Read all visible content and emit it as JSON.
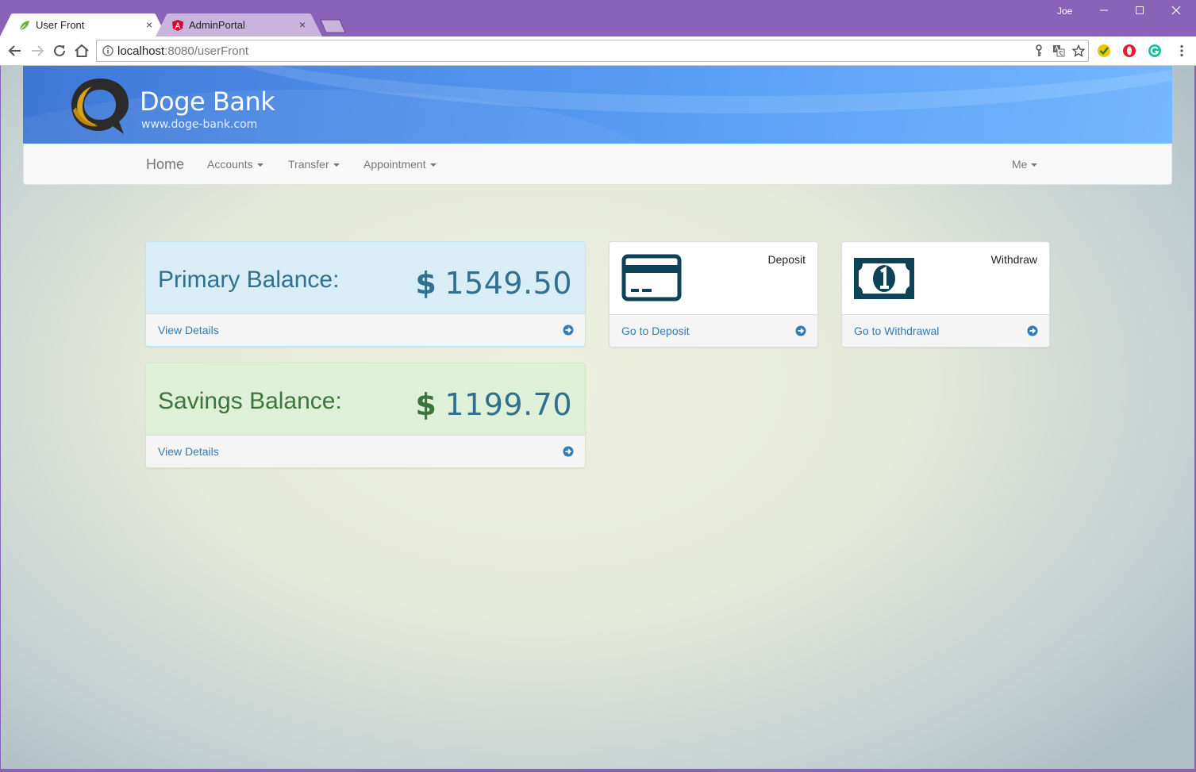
{
  "browser": {
    "tabs": [
      {
        "title": "User Front",
        "active": true
      },
      {
        "title": "AdminPortal",
        "active": false
      }
    ],
    "profile_name": "Joe",
    "url_host": "localhost",
    "url_rest": ":8080/userFront",
    "tab_close_glyph": "×"
  },
  "brand": {
    "name": "Doge Bank",
    "website": "www.doge-bank.com"
  },
  "nav": {
    "home": "Home",
    "accounts": "Accounts",
    "transfer": "Transfer",
    "appointment": "Appointment",
    "me": "Me"
  },
  "primary": {
    "label": "Primary Balance:",
    "currency": "$",
    "amount": "1549.50",
    "link": "View Details",
    "color": "#31708f",
    "bg": "#d9edf7"
  },
  "savings": {
    "label": "Savings Balance:",
    "currency": "$",
    "amount": "1199.70",
    "link": "View Details",
    "color": "#3c763d",
    "bg": "#dff0d8"
  },
  "deposit": {
    "title": "Deposit",
    "link": "Go to Deposit",
    "icon": "credit-card-icon"
  },
  "withdraw": {
    "title": "Withdraw",
    "link": "Go to Withdrawal",
    "icon": "money-bill-icon"
  },
  "colors": {
    "icon_dark": "#0d4257",
    "link": "#337ab7",
    "chrome_frame": "#8a62b8"
  }
}
